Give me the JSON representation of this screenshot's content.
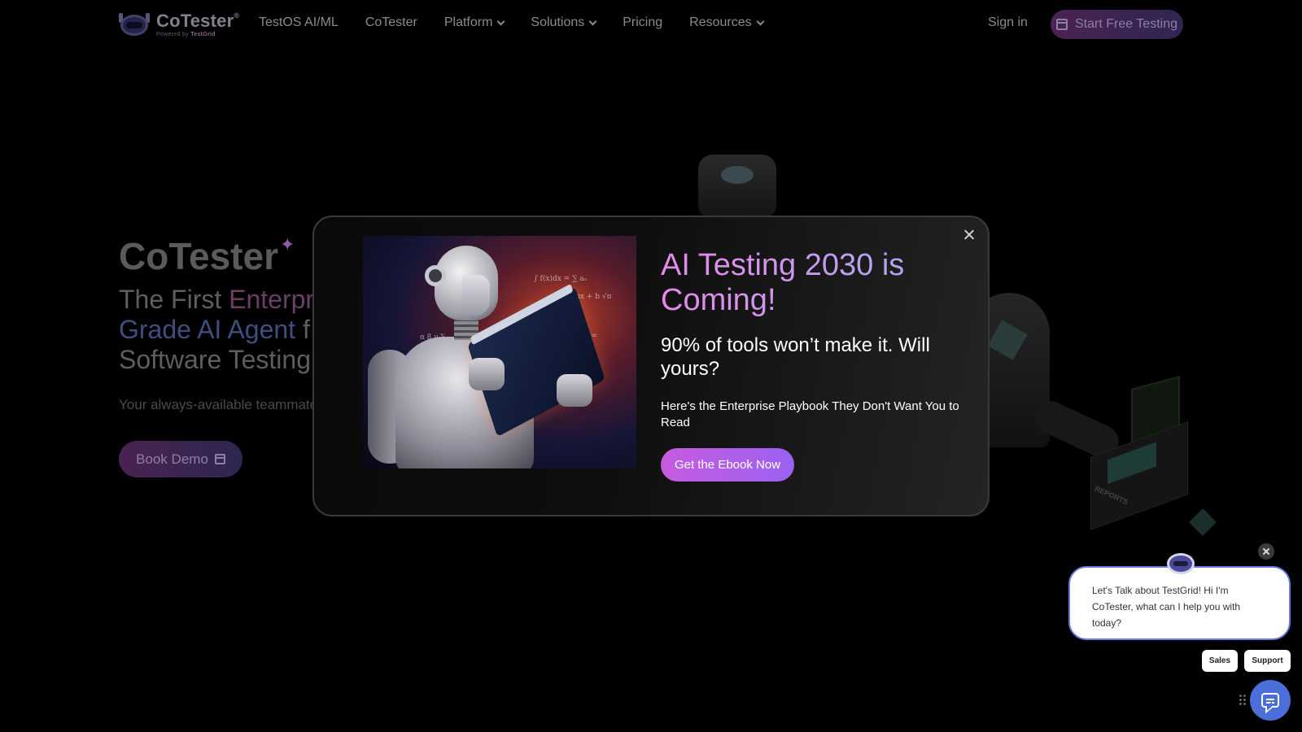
{
  "nav": {
    "logo_name": "CoTester",
    "logo_trademark": "®",
    "logo_powered": "Powered by",
    "logo_brand": "TestGrid",
    "items": [
      {
        "label": "TestOS AI/ML",
        "dropdown": false
      },
      {
        "label": "CoTester",
        "dropdown": false
      },
      {
        "label": "Platform",
        "dropdown": true
      },
      {
        "label": "Solutions",
        "dropdown": true
      },
      {
        "label": "Pricing",
        "dropdown": false
      },
      {
        "label": "Resources",
        "dropdown": true
      }
    ],
    "sign_in": "Sign in",
    "start_btn": "Start Free Testing"
  },
  "hero": {
    "title": "CoTester",
    "title_star": "✦",
    "sub_1": "The First ",
    "sub_2": "Enterpr",
    "sub_3": "Grade AI Agent",
    "sub_4": " f",
    "sub_5": "Software Testing",
    "desc": "Your always-available teammate",
    "book_btn": "Book Demo"
  },
  "modal": {
    "title": "AI Testing 2030 is Coming!",
    "subtitle": "90% of tools won’t make it. Will yours?",
    "description": "Here's the Enterprise Playbook They Don't Want You to Read",
    "cta": "Get the Ebook Now"
  },
  "chat": {
    "message": "Let's Talk about TestGrid! Hi I'm CoTester, what can I help you with today?",
    "chip_sales": "Sales",
    "chip_support": "Support"
  },
  "decor": {
    "reports_label": "REPORTS"
  },
  "colors": {
    "accent_gradient_start": "#c65be0",
    "accent_gradient_end": "#9a62f0",
    "chat_launcher": "#4b6ed8",
    "chat_border": "#6a7ae0"
  }
}
